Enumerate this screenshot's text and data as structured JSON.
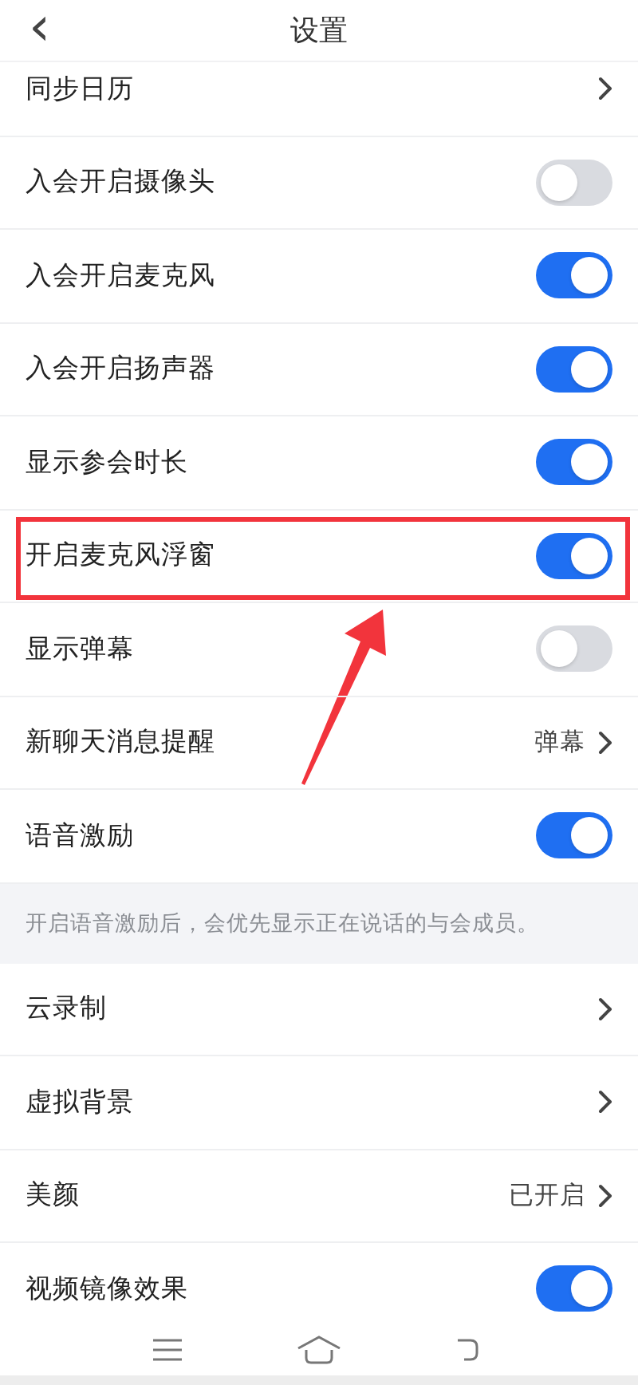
{
  "header": {
    "back_icon": "‹",
    "title": "设置"
  },
  "groups": [
    {
      "rows": [
        {
          "kind": "link",
          "label": "同步日历",
          "highlighted": false
        },
        {
          "kind": "toggle",
          "label": "入会开启摄像头",
          "on": false,
          "highlighted": false
        },
        {
          "kind": "toggle",
          "label": "入会开启麦克风",
          "on": true,
          "highlighted": false
        },
        {
          "kind": "toggle",
          "label": "入会开启扬声器",
          "on": true,
          "highlighted": false
        },
        {
          "kind": "toggle",
          "label": "显示参会时长",
          "on": true,
          "highlighted": false
        },
        {
          "kind": "toggle",
          "label": "开启麦克风浮窗",
          "on": true,
          "highlighted": true
        },
        {
          "kind": "toggle",
          "label": "显示弹幕",
          "on": false,
          "highlighted": false
        },
        {
          "kind": "link",
          "label": "新聊天消息提醒",
          "value": "弹幕",
          "highlighted": false
        },
        {
          "kind": "toggle",
          "label": "语音激励",
          "on": true,
          "highlighted": false
        }
      ],
      "note": "开启语音激励后，会优先显示正在说话的与会成员。"
    },
    {
      "rows": [
        {
          "kind": "link",
          "label": "云录制",
          "highlighted": false
        },
        {
          "kind": "link",
          "label": "虚拟背景",
          "highlighted": false
        },
        {
          "kind": "link",
          "label": "美颜",
          "value": "已开启",
          "highlighted": false
        },
        {
          "kind": "toggle",
          "label": "视频镜像效果",
          "on": true,
          "highlighted": false
        }
      ]
    }
  ]
}
